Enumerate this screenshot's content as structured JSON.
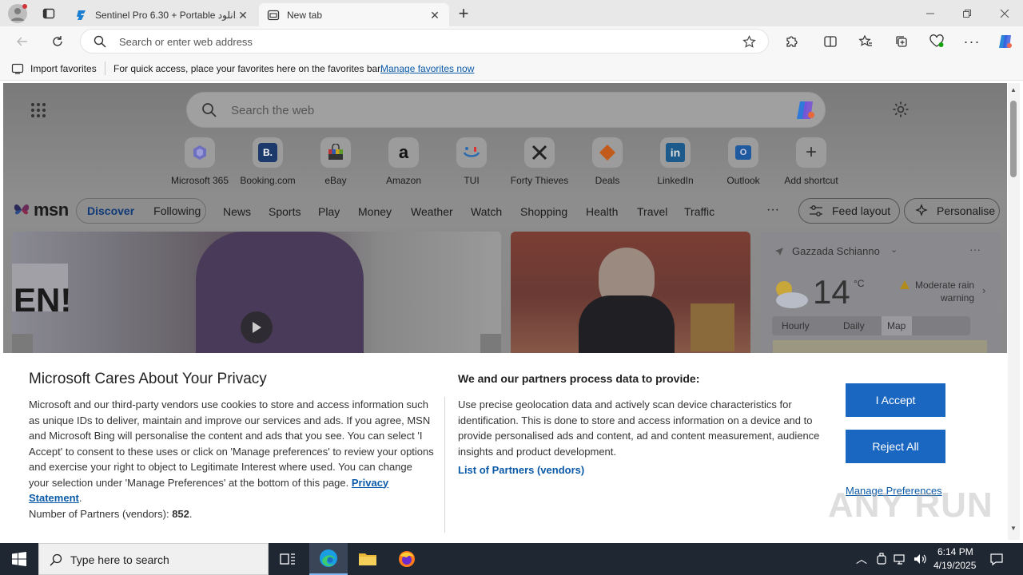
{
  "browser": {
    "tabs": [
      {
        "label": "Sentinel Pro 6.30 + Portable دانلود",
        "active": false
      },
      {
        "label": "New tab",
        "active": true
      }
    ],
    "address_placeholder": "Search or enter web address"
  },
  "favorites_bar": {
    "import_label": "Import favorites",
    "hint": "For quick access, place your favorites here on the favorites bar.",
    "manage_link": "Manage favorites now"
  },
  "newtab": {
    "search_placeholder": "Search the web",
    "shortcuts": [
      {
        "label": "Microsoft 365",
        "icon": "m365-icon"
      },
      {
        "label": "Booking.com",
        "icon": "booking-icon"
      },
      {
        "label": "eBay",
        "icon": "ebay-icon"
      },
      {
        "label": "Amazon",
        "icon": "amazon-icon"
      },
      {
        "label": "TUI",
        "icon": "tui-icon"
      },
      {
        "label": "Forty Thieves",
        "icon": "forty-thieves-icon"
      },
      {
        "label": "Deals",
        "icon": "deals-icon"
      },
      {
        "label": "LinkedIn",
        "icon": "linkedin-icon"
      },
      {
        "label": "Outlook",
        "icon": "outlook-icon"
      },
      {
        "label": "Add shortcut",
        "icon": "plus-icon"
      }
    ],
    "msn": {
      "logo": "msn",
      "pills": [
        "Discover",
        "Following"
      ],
      "nav": [
        "News",
        "Sports",
        "Play",
        "Money",
        "Weather",
        "Watch",
        "Shopping",
        "Health",
        "Travel",
        "Traffic"
      ],
      "more": "···",
      "feed_layout": "Feed layout",
      "personalise": "Personalise"
    },
    "weather": {
      "location": "Gazzada Schianno",
      "temp": "14",
      "unit": "°C",
      "alert_line1": "Moderate rain",
      "alert_line2": "warning",
      "tabs": [
        "Hourly",
        "Daily",
        "Map"
      ]
    }
  },
  "privacy": {
    "title": "Microsoft Cares About Your Privacy",
    "body": "Microsoft and our third-party vendors use cookies to store and access information such as unique IDs to deliver, maintain and improve our services and ads. If you agree, MSN and Microsoft Bing will personalise the content and ads that you see. You can select 'I Accept' to consent to these uses or click on 'Manage preferences' to review your options and exercise your right to object to Legitimate Interest where used.  You can change your selection under 'Manage Preferences' at the bottom of this page.",
    "privacy_link": "Privacy Statement",
    "partners_label": "Number of Partners (vendors):",
    "partners_count": "852",
    "right_title": "We and our partners process data to provide:",
    "right_body": "Use precise geolocation data and actively scan device characteristics for identification. This is done to store and access information on a device and to provide personalised ads and content, ad and content measurement, audience insights and product development.",
    "vendors_link": "List of Partners (vendors)",
    "accept": "I Accept",
    "reject": "Reject All",
    "manage": "Manage Preferences"
  },
  "taskbar": {
    "search_placeholder": "Type here to search",
    "time": "6:14 PM",
    "date": "4/19/2025"
  },
  "watermark": "ANY RUN",
  "colors": {
    "accent": "#1a67c1",
    "link": "#0b5aa8",
    "taskbar": "#1f2733"
  }
}
